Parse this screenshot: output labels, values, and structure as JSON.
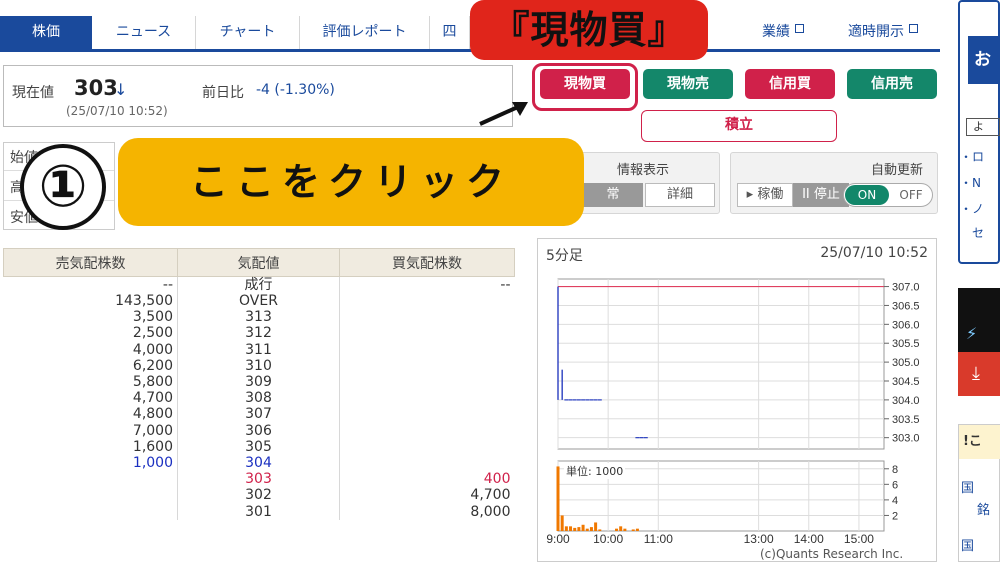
{
  "tabs": [
    "株価",
    "ニュース",
    "チャート",
    "評価レポート",
    "四"
  ],
  "links": [
    "業績",
    "適時開示"
  ],
  "price": {
    "label": "現在値",
    "value": "303",
    "arrow": "↓",
    "time": "(25/07/10 10:52)",
    "change_label": "前日比",
    "change_value": "-4 (-1.30%)"
  },
  "buttons": {
    "genbutsu_kai": "現物買",
    "genbutsu_uri": "現物売",
    "shinyo_kai": "信用買",
    "shinyo_uri": "信用売",
    "tsumitate": "積立"
  },
  "side_labels": [
    "始値",
    "高値",
    "安値"
  ],
  "display_panel": {
    "title": "情報表示",
    "normal": "常",
    "detail": "詳細"
  },
  "auto_update": {
    "title": "自動更新",
    "running": "▸ 稼働",
    "stop": "II 停止",
    "on": "ON",
    "off": "OFF"
  },
  "callouts": {
    "top": "『現物買』",
    "number": "①",
    "main": "ここをクリック"
  },
  "board": {
    "headers": [
      "売気配株数",
      "気配値",
      "買気配株数"
    ],
    "rows": [
      [
        "--",
        "成行",
        "--"
      ],
      [
        "143,500",
        "OVER",
        ""
      ],
      [
        "3,500",
        "313",
        ""
      ],
      [
        "2,500",
        "312",
        ""
      ],
      [
        "4,000",
        "311",
        ""
      ],
      [
        "6,200",
        "310",
        ""
      ],
      [
        "5,800",
        "309",
        ""
      ],
      [
        "4,700",
        "308",
        ""
      ],
      [
        "4,800",
        "307",
        ""
      ],
      [
        "7,000",
        "306",
        ""
      ],
      [
        "1,600",
        "305",
        ""
      ],
      [
        "1,000",
        "304",
        ""
      ],
      [
        "",
        "303",
        "400"
      ],
      [
        "",
        "302",
        "4,700"
      ],
      [
        "",
        "301",
        "8,000"
      ]
    ],
    "colors": {
      "sell_highlight": "#1a2fc0",
      "buy_highlight": "#d0214a"
    }
  },
  "chart_panel": {
    "interval": "5分足",
    "timestamp": "25/07/10 10:52",
    "volume_unit": "単位: 1000",
    "credit": "(c)Quants Research Inc."
  },
  "chart_data": [
    {
      "type": "line",
      "ytick_labels": [
        "307.0",
        "306.5",
        "306.0",
        "305.5",
        "305.0",
        "304.5",
        "304.0",
        "303.5",
        "303.0"
      ],
      "ylim": [
        302.7,
        307.2
      ],
      "reference_line": 307.0,
      "x": [
        "9:00",
        "9:05",
        "9:10",
        "9:15",
        "9:20",
        "9:25",
        "9:30",
        "9:35",
        "9:40",
        "9:45",
        "9:50",
        "10:35",
        "10:40",
        "10:45"
      ],
      "high": [
        307.0,
        304.8,
        304.0,
        304.0,
        304.0,
        304.0,
        304.0,
        304.0,
        304.0,
        304.0,
        304.0,
        303.0,
        303.0,
        303.0
      ],
      "low": [
        304.0,
        304.0,
        304.0,
        304.0,
        304.0,
        304.0,
        304.0,
        304.0,
        304.0,
        304.0,
        304.0,
        303.0,
        303.0,
        303.0
      ]
    },
    {
      "type": "bar",
      "ytick_labels": [
        "8",
        "6",
        "4",
        "2"
      ],
      "ylim": [
        0,
        9
      ],
      "x": [
        "9:00",
        "9:05",
        "9:10",
        "9:15",
        "9:20",
        "9:25",
        "9:30",
        "9:35",
        "9:40",
        "9:45",
        "9:50",
        "9:55",
        "10:00",
        "10:05",
        "10:10",
        "10:15",
        "10:20",
        "10:25",
        "10:30",
        "10:35"
      ],
      "values": [
        8.3,
        2.0,
        0.6,
        0.6,
        0.4,
        0.5,
        0.8,
        0.3,
        0.5,
        1.1,
        0.2,
        0,
        0,
        0,
        0.3,
        0.6,
        0.3,
        0,
        0.2,
        0.3
      ]
    }
  ],
  "time_axis": [
    "9:00",
    "10:00",
    "11:00",
    "13:00",
    "14:00",
    "15:00"
  ],
  "right_column": {
    "items": [
      "・ロ",
      "・N",
      "・ノ",
      "セ"
    ],
    "top_char": "お",
    "box_char": "よ",
    "notice": "!こ",
    "links": [
      "国",
      "銘",
      "国"
    ]
  }
}
